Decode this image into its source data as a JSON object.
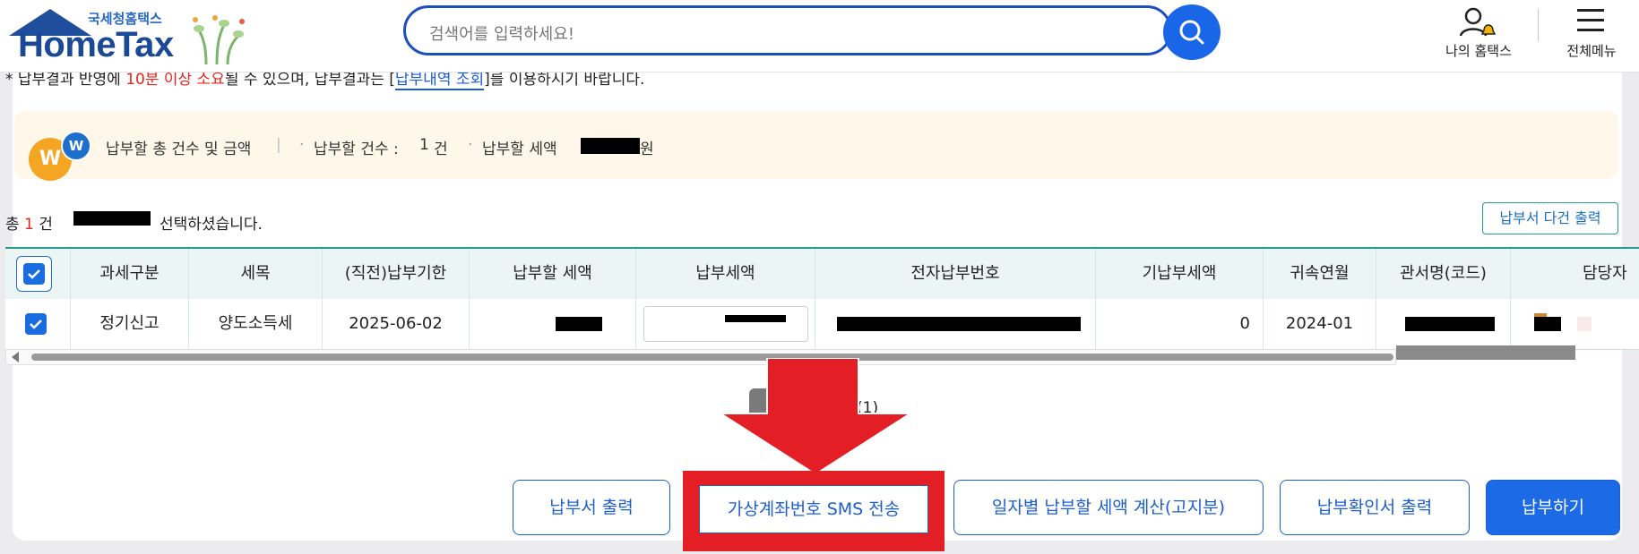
{
  "header": {
    "logo_small": "국세청홈택스",
    "logo_brand": "HomeTax",
    "search_placeholder": "검색어를 입력하세요!",
    "my_hometax": "나의 홈택스",
    "all_menu": "전체메뉴"
  },
  "notice": {
    "prefix": "* 납부결과 반영에 ",
    "red": "10분 이상 소요",
    "middle": "될 수 있으며, 납부결과는 [",
    "link": "납부내역 조회",
    "suffix": "]를 이용하시기 바랍니다."
  },
  "summary": {
    "title": "납부할 총 건수 및 금액",
    "sep": "|",
    "count_label": "납부할 건수 :",
    "count_value": "1",
    "count_unit": "건",
    "amount_label": "납부할 세액",
    "amount_unit": "원",
    "coin_orange": "W",
    "coin_blue": "W"
  },
  "selection": {
    "prefix": "총",
    "count": "1",
    "unit": "건",
    "suffix": "선택하셨습니다.",
    "multi_print": "납부서 다건 출력"
  },
  "table": {
    "headers": [
      "과세구분",
      "세목",
      "(직전)납부기한",
      "납부할 세액",
      "납부세액",
      "전자납부번호",
      "기납부세액",
      "귀속연월",
      "관서명(코드)",
      "담당자"
    ],
    "row": {
      "tax_type": "정기신고",
      "item": "양도소득세",
      "due_date": "2025-06-02",
      "prepaid": "0",
      "period": "2024-01"
    }
  },
  "pagination": {
    "info": "(1)"
  },
  "actions": {
    "print_bill": "납부서 출력",
    "sms": "가상계좌번호 SMS 전송",
    "daily_calc": "일자별 납부할 세액 계산(고지분)",
    "confirm_print": "납부확인서 출력",
    "pay": "납부하기"
  },
  "colors": {
    "brand_blue": "#1c6ae6",
    "highlight_red": "#e41e25",
    "table_accent": "#2a9a8e"
  }
}
